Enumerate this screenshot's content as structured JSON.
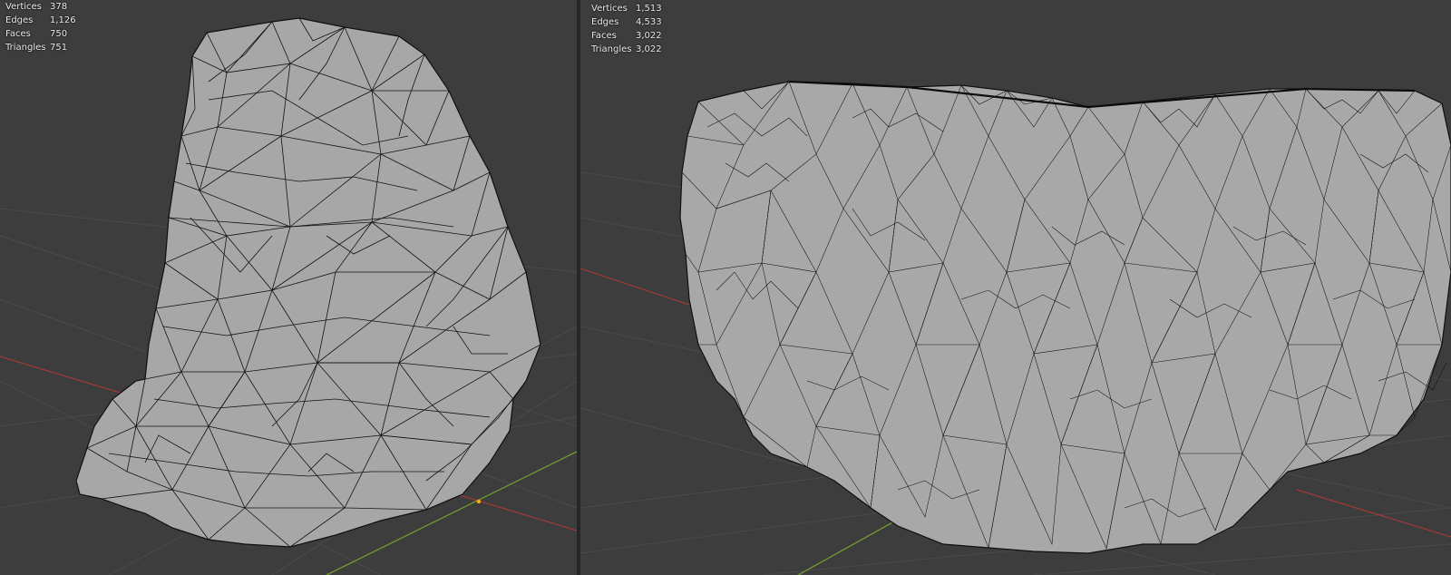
{
  "viewports": [
    {
      "stats": [
        {
          "label": "Vertices",
          "value": "378"
        },
        {
          "label": "Edges",
          "value": "1,126"
        },
        {
          "label": "Faces",
          "value": "750"
        },
        {
          "label": "Triangles",
          "value": "751"
        }
      ]
    },
    {
      "stats": [
        {
          "label": "Vertices",
          "value": "1,513"
        },
        {
          "label": "Edges",
          "value": "4,533"
        },
        {
          "label": "Faces",
          "value": "3,022"
        },
        {
          "label": "Triangles",
          "value": "3,022"
        }
      ]
    }
  ],
  "colors": {
    "viewport_bg": "#3d3d3d",
    "grid_line": "#4a4a4a",
    "x_axis": "#9c3a3a",
    "y_axis": "#6f9a33",
    "mesh_fill": "#a6a6a6",
    "wire": "#111111",
    "origin": "#ffaa00"
  }
}
